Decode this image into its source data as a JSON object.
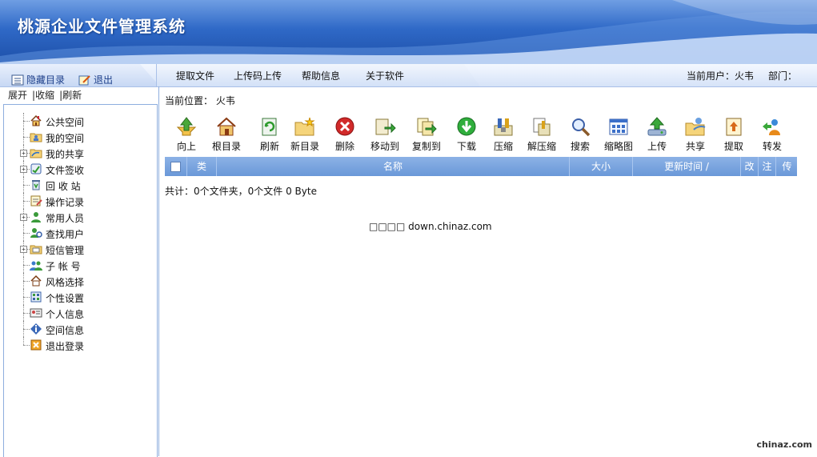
{
  "app": {
    "title": "桃源企业文件管理系统"
  },
  "left_links": {
    "hide": "隐藏目录",
    "exit": "退出"
  },
  "top_menu": [
    "提取文件",
    "上传码上传",
    "帮助信息",
    "关于软件"
  ],
  "user": {
    "current_label": "当前用户：火韦",
    "dept_label": "部门："
  },
  "tree_actions": [
    "展开",
    "|收缩",
    "|刷新"
  ],
  "tree": [
    {
      "label": "公共空间",
      "icon": "home-icon",
      "expandable": false
    },
    {
      "label": "我的空间",
      "icon": "folder-user-icon",
      "expandable": false
    },
    {
      "label": "我的共享",
      "icon": "share-folder-icon",
      "expandable": true
    },
    {
      "label": "文件签收",
      "icon": "sign-icon",
      "expandable": true
    },
    {
      "label": "回 收 站",
      "icon": "recycle-icon",
      "expandable": false
    },
    {
      "label": "操作记录",
      "icon": "log-icon",
      "expandable": false
    },
    {
      "label": "常用人员",
      "icon": "person-icon",
      "expandable": true
    },
    {
      "label": "查找用户",
      "icon": "find-user-icon",
      "expandable": false
    },
    {
      "label": "短信管理",
      "icon": "sms-icon",
      "expandable": true
    },
    {
      "label": "子 帐 号",
      "icon": "group-icon",
      "expandable": false
    },
    {
      "label": "风格选择",
      "icon": "style-icon",
      "expandable": false
    },
    {
      "label": "个性设置",
      "icon": "settings-icon",
      "expandable": false
    },
    {
      "label": "个人信息",
      "icon": "id-card-icon",
      "expandable": false
    },
    {
      "label": "空间信息",
      "icon": "info-icon",
      "expandable": false
    },
    {
      "label": "退出登录",
      "icon": "logout-icon",
      "expandable": false
    }
  ],
  "breadcrumb": {
    "label": "当前位置：",
    "path": "火韦"
  },
  "toolbar": [
    {
      "label": "向上",
      "icon": "up-icon"
    },
    {
      "label": "根目录",
      "icon": "root-home-icon"
    },
    {
      "label": "刷新",
      "icon": "refresh-icon"
    },
    {
      "label": "新目录",
      "icon": "new-folder-icon"
    },
    {
      "label": "删除",
      "icon": "delete-icon"
    },
    {
      "label": "移动到",
      "icon": "move-icon"
    },
    {
      "label": "复制到",
      "icon": "copy-icon"
    },
    {
      "label": "下载",
      "icon": "download-icon"
    },
    {
      "label": "压缩",
      "icon": "compress-icon"
    },
    {
      "label": "解压缩",
      "icon": "extract-icon"
    },
    {
      "label": "搜索",
      "icon": "search-icon"
    },
    {
      "label": "缩略图",
      "icon": "thumbnail-icon"
    },
    {
      "label": "上传",
      "icon": "upload-icon"
    },
    {
      "label": "共享",
      "icon": "share-icon"
    },
    {
      "label": "提取",
      "icon": "extract-file-icon"
    },
    {
      "label": "转发",
      "icon": "forward-icon"
    }
  ],
  "table": {
    "columns": [
      "类",
      "名称",
      "大小",
      "更新时间 /",
      "改",
      "注",
      "传"
    ]
  },
  "summary": "共计：0个文件夹，0个文件  0 Byte",
  "watermark": "□□□□ down.chinaz.com",
  "corner_mark": "chinaz.com",
  "colors": {
    "header_blue": "#2f69c7",
    "table_header": "#7aa4de",
    "border": "#8eaede"
  }
}
